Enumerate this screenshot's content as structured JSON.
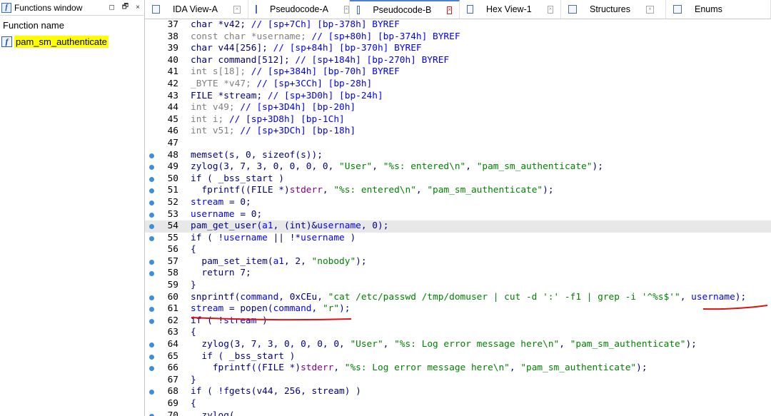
{
  "functions_window": {
    "title": "Functions window",
    "controls": [
      "◻",
      "🗗",
      "×"
    ],
    "header": "Function name",
    "items": [
      {
        "name": "pam_sm_authenticate",
        "icon": "function-f-icon",
        "selected": true
      }
    ]
  },
  "tabs": [
    {
      "label": "IDA View-A",
      "icon": "ida-view-icon",
      "active": false
    },
    {
      "label": "Pseudocode-A",
      "icon": "pseudocode-icon",
      "active": false
    },
    {
      "label": "Pseudocode-B",
      "icon": "pseudocode-icon",
      "active": true
    },
    {
      "label": "Hex View-1",
      "icon": "hex-view-icon",
      "active": false
    },
    {
      "label": "Structures",
      "icon": "structures-icon",
      "active": false
    },
    {
      "label": "Enums",
      "icon": "enums-icon",
      "active": false
    }
  ],
  "colors": {
    "keyword": "#000080",
    "comment": "#0000ff",
    "string": "#008000",
    "macro": "#800080",
    "highlight_line": "#e8e8e8",
    "func_highlight": "#ffff00",
    "breakpoint_dot": "#3c8ee0",
    "annotation": "#e01010",
    "active_tab": "#4a7fd4"
  },
  "code_lines": [
    {
      "n": "37",
      "dot": false,
      "hl": false,
      "parts": [
        [
          "pl",
          "char *v42; "
        ],
        [
          "cm",
          "// [sp+7Ch] [bp-378h] BYREF"
        ]
      ]
    },
    {
      "n": "38",
      "dot": false,
      "hl": false,
      "parts": [
        [
          "gray",
          "const char *username; "
        ],
        [
          "cm",
          "// [sp+80h] [bp-374h] BYREF"
        ]
      ]
    },
    {
      "n": "39",
      "dot": false,
      "hl": false,
      "parts": [
        [
          "pl",
          "char v44[256]; "
        ],
        [
          "cm",
          "// [sp+84h] [bp-370h] BYREF"
        ]
      ]
    },
    {
      "n": "40",
      "dot": false,
      "hl": false,
      "parts": [
        [
          "pl",
          "char command[512]; "
        ],
        [
          "cm",
          "// [sp+184h] [bp-270h] BYREF"
        ]
      ]
    },
    {
      "n": "41",
      "dot": false,
      "hl": false,
      "parts": [
        [
          "gray",
          "int s[18]; "
        ],
        [
          "cm",
          "// [sp+384h] [bp-70h] BYREF"
        ]
      ]
    },
    {
      "n": "42",
      "dot": false,
      "hl": false,
      "parts": [
        [
          "gray",
          "_BYTE *v47; "
        ],
        [
          "cm",
          "// [sp+3CCh] [bp-28h]"
        ]
      ]
    },
    {
      "n": "43",
      "dot": false,
      "hl": false,
      "parts": [
        [
          "pl",
          "FILE *stream; "
        ],
        [
          "cm",
          "// [sp+3D0h] [bp-24h]"
        ]
      ]
    },
    {
      "n": "44",
      "dot": false,
      "hl": false,
      "parts": [
        [
          "gray",
          "int v49; "
        ],
        [
          "cm",
          "// [sp+3D4h] [bp-20h]"
        ]
      ]
    },
    {
      "n": "45",
      "dot": false,
      "hl": false,
      "parts": [
        [
          "gray",
          "int i; "
        ],
        [
          "cm",
          "// [sp+3D8h] [bp-1Ch]"
        ]
      ]
    },
    {
      "n": "46",
      "dot": false,
      "hl": false,
      "parts": [
        [
          "gray",
          "int v51; "
        ],
        [
          "cm",
          "// [sp+3DCh] [bp-18h]"
        ]
      ]
    },
    {
      "n": "47",
      "dot": false,
      "hl": false,
      "parts": []
    },
    {
      "n": "48",
      "dot": true,
      "hl": false,
      "parts": [
        [
          "pl",
          "memset(s, 0, sizeof(s));"
        ]
      ]
    },
    {
      "n": "49",
      "dot": true,
      "hl": false,
      "parts": [
        [
          "pl",
          "zylog(3, 7, 3, 0, 0, 0, 0, "
        ],
        [
          "str",
          "\"User\""
        ],
        [
          "pl",
          ", "
        ],
        [
          "str",
          "\"%s: entered\\n\""
        ],
        [
          "pl",
          ", "
        ],
        [
          "str",
          "\"pam_sm_authenticate\""
        ],
        [
          "pl",
          ");"
        ]
      ]
    },
    {
      "n": "50",
      "dot": true,
      "hl": false,
      "parts": [
        [
          "pl",
          "if ( _bss_start )"
        ]
      ]
    },
    {
      "n": "51",
      "dot": true,
      "hl": false,
      "parts": [
        [
          "pl",
          "  fprintf((FILE *)"
        ],
        [
          "mac",
          "stderr"
        ],
        [
          "pl",
          ", "
        ],
        [
          "str",
          "\"%s: entered\\n\""
        ],
        [
          "pl",
          ", "
        ],
        [
          "str",
          "\"pam_sm_authenticate\""
        ],
        [
          "pl",
          ");"
        ]
      ]
    },
    {
      "n": "52",
      "dot": true,
      "hl": false,
      "parts": [
        [
          "var",
          "stream"
        ],
        [
          "pl",
          " = 0;"
        ]
      ]
    },
    {
      "n": "53",
      "dot": true,
      "hl": false,
      "parts": [
        [
          "var",
          "username"
        ],
        [
          "pl",
          " = 0;"
        ]
      ]
    },
    {
      "n": "54",
      "dot": true,
      "hl": true,
      "parts": [
        [
          "pl",
          "pam_get_user("
        ],
        [
          "var",
          "a1"
        ],
        [
          "pl",
          ", (int)&"
        ],
        [
          "var",
          "username"
        ],
        [
          "pl",
          ", 0);"
        ]
      ]
    },
    {
      "n": "55",
      "dot": true,
      "hl": false,
      "parts": [
        [
          "pl",
          "if ( !"
        ],
        [
          "var",
          "username"
        ],
        [
          "pl",
          " || !*"
        ],
        [
          "var",
          "username"
        ],
        [
          "pl",
          " )"
        ]
      ]
    },
    {
      "n": "56",
      "dot": false,
      "hl": false,
      "parts": [
        [
          "pl",
          "{"
        ]
      ]
    },
    {
      "n": "57",
      "dot": true,
      "hl": false,
      "parts": [
        [
          "pl",
          "  pam_set_item("
        ],
        [
          "var",
          "a1"
        ],
        [
          "pl",
          ", 2, "
        ],
        [
          "str",
          "\"nobody\""
        ],
        [
          "pl",
          ");"
        ]
      ]
    },
    {
      "n": "58",
      "dot": true,
      "hl": false,
      "parts": [
        [
          "pl",
          "  return 7;"
        ]
      ]
    },
    {
      "n": "59",
      "dot": false,
      "hl": false,
      "parts": [
        [
          "pl",
          "}"
        ]
      ]
    },
    {
      "n": "60",
      "dot": true,
      "hl": false,
      "parts": [
        [
          "pl",
          "snprintf("
        ],
        [
          "var",
          "command"
        ],
        [
          "pl",
          ", 0xCEu, "
        ],
        [
          "str",
          "\"cat /etc/passwd /tmp/domuser | cut -d ':' -f1 | grep -i '^%s$'\""
        ],
        [
          "pl",
          ", "
        ],
        [
          "var",
          "username"
        ],
        [
          "pl",
          ");"
        ]
      ]
    },
    {
      "n": "61",
      "dot": true,
      "hl": false,
      "parts": [
        [
          "var",
          "stream"
        ],
        [
          "pl",
          " = popen("
        ],
        [
          "var",
          "command"
        ],
        [
          "pl",
          ", "
        ],
        [
          "str",
          "\"r\""
        ],
        [
          "pl",
          ");"
        ]
      ]
    },
    {
      "n": "62",
      "dot": true,
      "hl": false,
      "parts": [
        [
          "pl",
          "if ( !"
        ],
        [
          "var",
          "stream"
        ],
        [
          "pl",
          " )"
        ]
      ]
    },
    {
      "n": "63",
      "dot": false,
      "hl": false,
      "parts": [
        [
          "pl",
          "{"
        ]
      ]
    },
    {
      "n": "64",
      "dot": true,
      "hl": false,
      "parts": [
        [
          "pl",
          "  zylog(3, 7, 3, 0, 0, 0, 0, "
        ],
        [
          "str",
          "\"User\""
        ],
        [
          "pl",
          ", "
        ],
        [
          "str",
          "\"%s: Log error message here\\n\""
        ],
        [
          "pl",
          ", "
        ],
        [
          "str",
          "\"pam_sm_authenticate\""
        ],
        [
          "pl",
          ");"
        ]
      ]
    },
    {
      "n": "65",
      "dot": true,
      "hl": false,
      "parts": [
        [
          "pl",
          "  if ( _bss_start )"
        ]
      ]
    },
    {
      "n": "66",
      "dot": true,
      "hl": false,
      "parts": [
        [
          "pl",
          "    fprintf((FILE *)"
        ],
        [
          "mac",
          "stderr"
        ],
        [
          "pl",
          ", "
        ],
        [
          "str",
          "\"%s: Log error message here\\n\""
        ],
        [
          "pl",
          ", "
        ],
        [
          "str",
          "\"pam_sm_authenticate\""
        ],
        [
          "pl",
          ");"
        ]
      ]
    },
    {
      "n": "67",
      "dot": false,
      "hl": false,
      "parts": [
        [
          "pl",
          "}"
        ]
      ]
    },
    {
      "n": "68",
      "dot": true,
      "hl": false,
      "parts": [
        [
          "pl",
          "if ( !fgets(v44, 256, stream) )"
        ]
      ]
    },
    {
      "n": "69",
      "dot": false,
      "hl": false,
      "parts": [
        [
          "pl",
          "{"
        ]
      ]
    },
    {
      "n": "70",
      "dot": true,
      "hl": false,
      "parts": [
        [
          "pl",
          "  zylog("
        ]
      ]
    }
  ]
}
